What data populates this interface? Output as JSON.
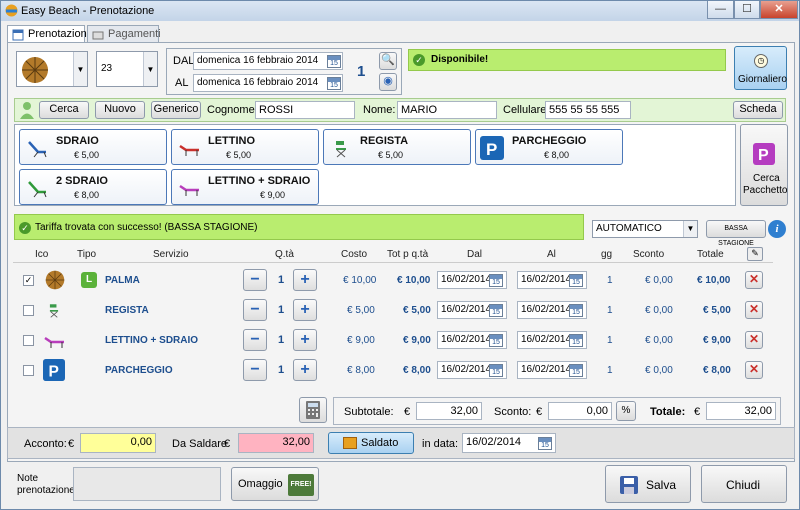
{
  "window": {
    "title": "Easy Beach - Prenotazione",
    "min": "—",
    "max": "☐",
    "close": "✕"
  },
  "tabs": [
    {
      "label": "Prenotazione"
    },
    {
      "label": "Pagamenti"
    }
  ],
  "top": {
    "umbrella_number": "23",
    "dal_label": "DAL",
    "al_label": "AL",
    "dal_value": "domenica 16 febbraio 2014",
    "al_value": "domenica 16 febbraio 2014",
    "days": "1",
    "status": "Disponibile!",
    "giornaliero": "Giornaliero",
    "cal_day": "15"
  },
  "customer": {
    "cerca": "Cerca",
    "nuovo": "Nuovo",
    "generico": "Generico",
    "cognome_label": "Cognome:",
    "cognome": "ROSSI",
    "nome_label": "Nome:",
    "nome": "MARIO",
    "cellulare_label": "Cellulare:",
    "cellulare": "555 55 55 555",
    "scheda": "Scheda"
  },
  "services": [
    {
      "name": "SDRAIO",
      "price": "€ 5,00"
    },
    {
      "name": "LETTINO",
      "price": "€ 5,00"
    },
    {
      "name": "REGISTA",
      "price": "€ 5,00"
    },
    {
      "name": "PARCHEGGIO",
      "price": "€ 8,00"
    },
    {
      "name": "2 SDRAIO",
      "price": "€ 8,00"
    },
    {
      "name": "LETTINO + SDRAIO",
      "price": "€ 9,00"
    }
  ],
  "cerca_pacchetto": {
    "line1": "Cerca",
    "line2": "Pacchetto"
  },
  "tariff": {
    "message": "Tariffa trovata con successo! (BASSA STAGIONE)",
    "mode": "AUTOMATICO",
    "season_btn": "BASSA STAGIONE"
  },
  "grid": {
    "headers": [
      "Ico",
      "Tipo",
      "Servizio",
      "Q.tà",
      "Costo",
      "Tot p q.tà",
      "Dal",
      "Al",
      "gg",
      "Sconto",
      "Totale"
    ],
    "rows": [
      {
        "service": "PALMA",
        "qty": "1",
        "cost": "€ 10,00",
        "tot": "€ 10,00",
        "dal": "16/02/2014",
        "al": "16/02/2014",
        "gg": "1",
        "sconto": "€ 0,00",
        "totale": "€ 10,00",
        "checked": true,
        "tipo": "L"
      },
      {
        "service": "REGISTA",
        "qty": "1",
        "cost": "€ 5,00",
        "tot": "€ 5,00",
        "dal": "16/02/2014",
        "al": "16/02/2014",
        "gg": "1",
        "sconto": "€ 0,00",
        "totale": "€ 5,00",
        "checked": false
      },
      {
        "service": "LETTINO + SDRAIO",
        "qty": "1",
        "cost": "€ 9,00",
        "tot": "€ 9,00",
        "dal": "16/02/2014",
        "al": "16/02/2014",
        "gg": "1",
        "sconto": "€ 0,00",
        "totale": "€ 9,00",
        "checked": false
      },
      {
        "service": "PARCHEGGIO",
        "qty": "1",
        "cost": "€ 8,00",
        "tot": "€ 8,00",
        "dal": "16/02/2014",
        "al": "16/02/2014",
        "gg": "1",
        "sconto": "€ 0,00",
        "totale": "€ 8,00",
        "checked": false
      }
    ]
  },
  "totals": {
    "subtotale_label": "Subtotale:",
    "euro": "€",
    "subtotale": "32,00",
    "sconto_label": "Sconto:",
    "sconto": "0,00",
    "pct": "%",
    "totale_label": "Totale:",
    "totale": "32,00"
  },
  "payment": {
    "acconto_label": "Acconto:",
    "acconto": "0,00",
    "da_saldare_label": "Da Saldare",
    "da_saldare": "32,00",
    "saldato": "Saldato",
    "in_data_label": "in data:",
    "in_data": "16/02/2014"
  },
  "footer": {
    "note_label_1": "Note",
    "note_label_2": "prenotazione:",
    "omaggio": "Omaggio",
    "free": "FREE!",
    "salva": "Salva",
    "chiudi": "Chiudi"
  },
  "colors": {
    "available_green": "#b9ed6f",
    "acconto_yellow": "#ffff99",
    "saldare_pink": "#ffb3c1",
    "accent_blue": "#1d4e8e"
  }
}
